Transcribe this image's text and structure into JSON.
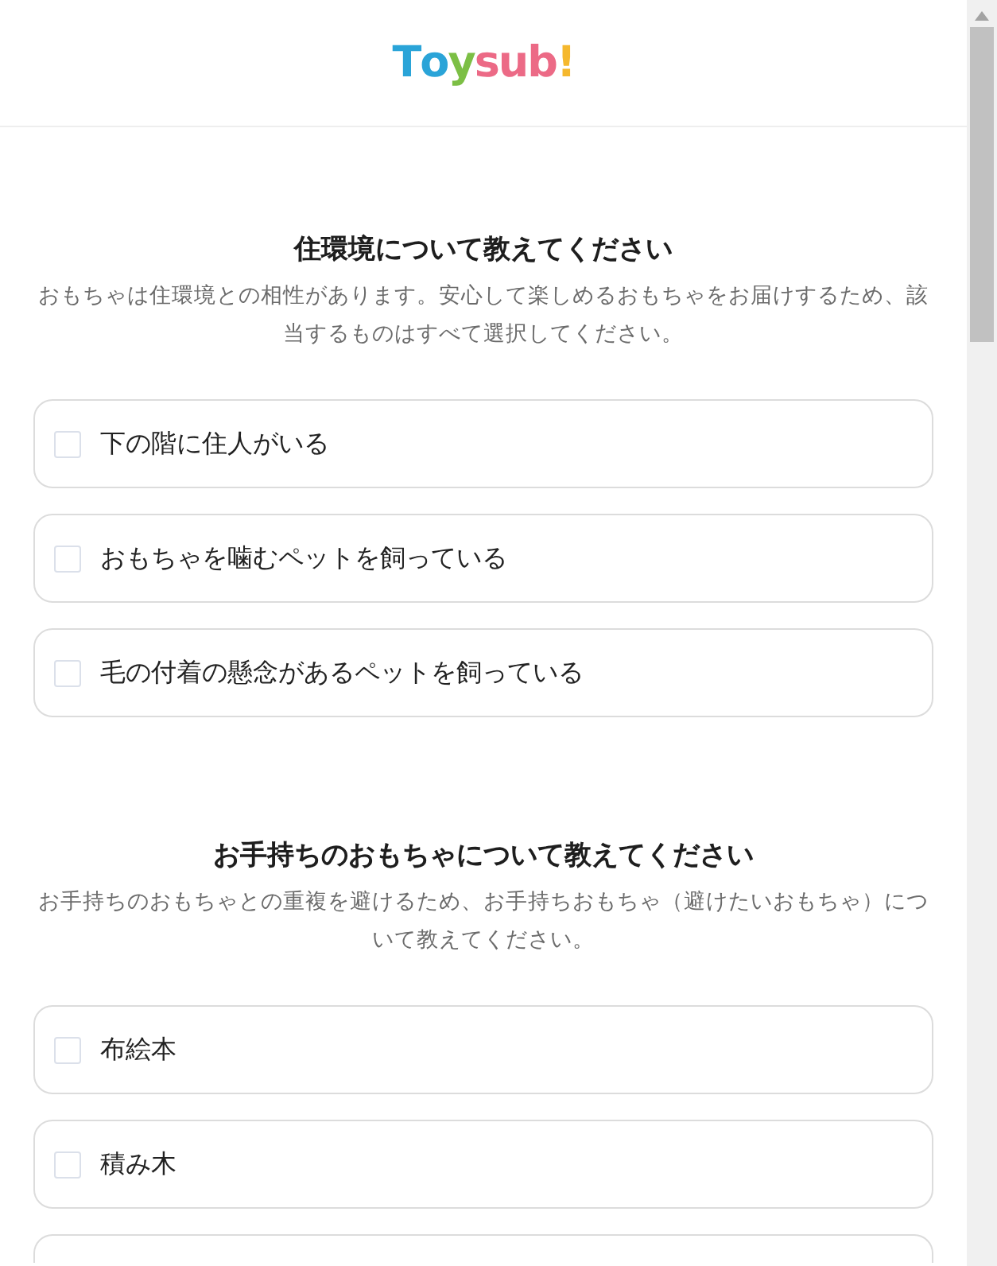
{
  "logo": {
    "letters": [
      {
        "char": "T",
        "color": "#2aa4d8"
      },
      {
        "char": "o",
        "color": "#2aa4d8"
      },
      {
        "char": "y",
        "color": "#7cbf45"
      },
      {
        "char": "s",
        "color": "#ec6a86"
      },
      {
        "char": "u",
        "color": "#ec6a86"
      },
      {
        "char": "b",
        "color": "#ec6a86"
      },
      {
        "char": "!",
        "color": "#f5b82e"
      }
    ]
  },
  "sections": [
    {
      "title": "住環境について教えてください",
      "description": "おもちゃは住環境との相性があります。安心して楽しめるおもちゃをお届けするため、該当するものはすべて選択してください。",
      "options": [
        {
          "kind": "option",
          "label": "下の階に住人がいる",
          "checked": false
        },
        {
          "kind": "option",
          "label": "おもちゃを噛むペットを飼っている",
          "checked": false
        },
        {
          "kind": "option",
          "label": "毛の付着の懸念があるペットを飼っている",
          "checked": false
        }
      ]
    },
    {
      "title": "お手持ちのおもちゃについて教えてください",
      "description": "お手持ちのおもちゃとの重複を避けるため、お手持ちおもちゃ（避けたいおもちゃ）について教えてください。",
      "options": [
        {
          "kind": "option",
          "label": "布絵本",
          "checked": false
        },
        {
          "kind": "option",
          "label": "積み木",
          "checked": false
        },
        {
          "kind": "partial"
        }
      ]
    }
  ]
}
